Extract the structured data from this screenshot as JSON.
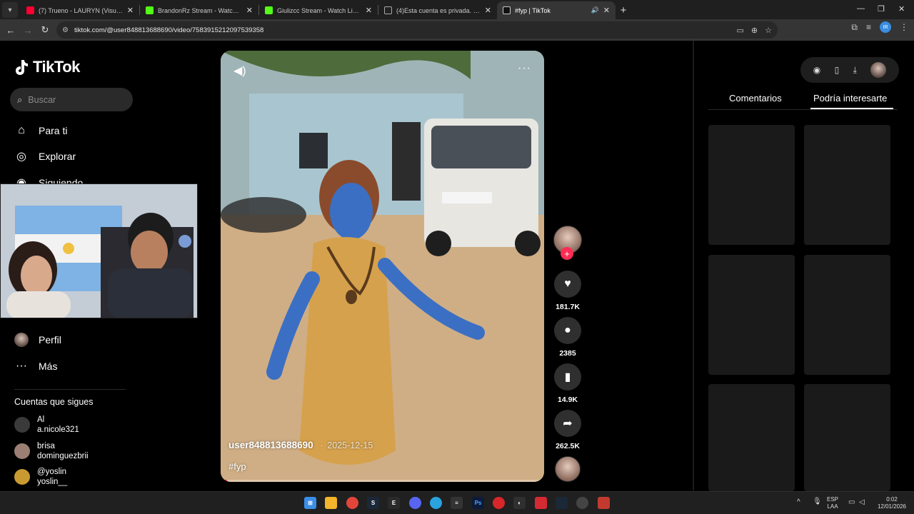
{
  "browser": {
    "tabs": [
      {
        "title": "(7) Trueno - LAURYN (Visualizer",
        "favicon_color": "#ff0033",
        "active": false
      },
      {
        "title": "BrandonRz Stream - Watch Live",
        "favicon_color": "#53fc18",
        "active": false
      },
      {
        "title": "Giulizcc Stream - Watch Live on",
        "favicon_color": "#53fc18",
        "active": false
      },
      {
        "title": "(4)Esta cuenta es privada. Sigue",
        "favicon_color": "#ffffff",
        "active": false
      },
      {
        "title": "#fyp | TikTok",
        "favicon_color": "#ffffff",
        "active": true
      }
    ],
    "url": "tiktok.com/@user848813688690/video/7583915212097539358",
    "new_tab": "+",
    "profile_initials": "IR"
  },
  "sidebar": {
    "logo": "TikTok",
    "search_placeholder": "Buscar",
    "nav": [
      {
        "label": "Para ti",
        "icon": "home-icon"
      },
      {
        "label": "Explorar",
        "icon": "compass-icon"
      },
      {
        "label": "Siguiendo",
        "icon": "following-icon"
      },
      {
        "label": "Perfil",
        "icon": "profile-avatar-icon"
      },
      {
        "label": "Más",
        "icon": "more-dots-icon"
      }
    ],
    "following_title": "Cuentas que sigues",
    "accounts": [
      {
        "name": "Al",
        "handle": "a.nicole321",
        "color": "#3a3a3a"
      },
      {
        "name": "brisa",
        "handle": "dominguezbrii",
        "color": "#9c7f74"
      },
      {
        "name": "@yoslin",
        "handle": "yoslin__",
        "color": "#c99a32"
      }
    ]
  },
  "video": {
    "author": "user848813688690",
    "date": "2025-12-15",
    "caption": "#fyp",
    "progress": 0.02
  },
  "actions": {
    "likes": "181.7K",
    "comments": "2385",
    "saves": "14.9K",
    "shares": "262.5K"
  },
  "right_panel": {
    "tab_comments": "Comentarios",
    "tab_suggested": "Podría interesarte"
  },
  "taskbar": {
    "lang_top": "ESP",
    "lang_bottom": "LAA",
    "time": "0:02",
    "date": "12/01/2026"
  }
}
